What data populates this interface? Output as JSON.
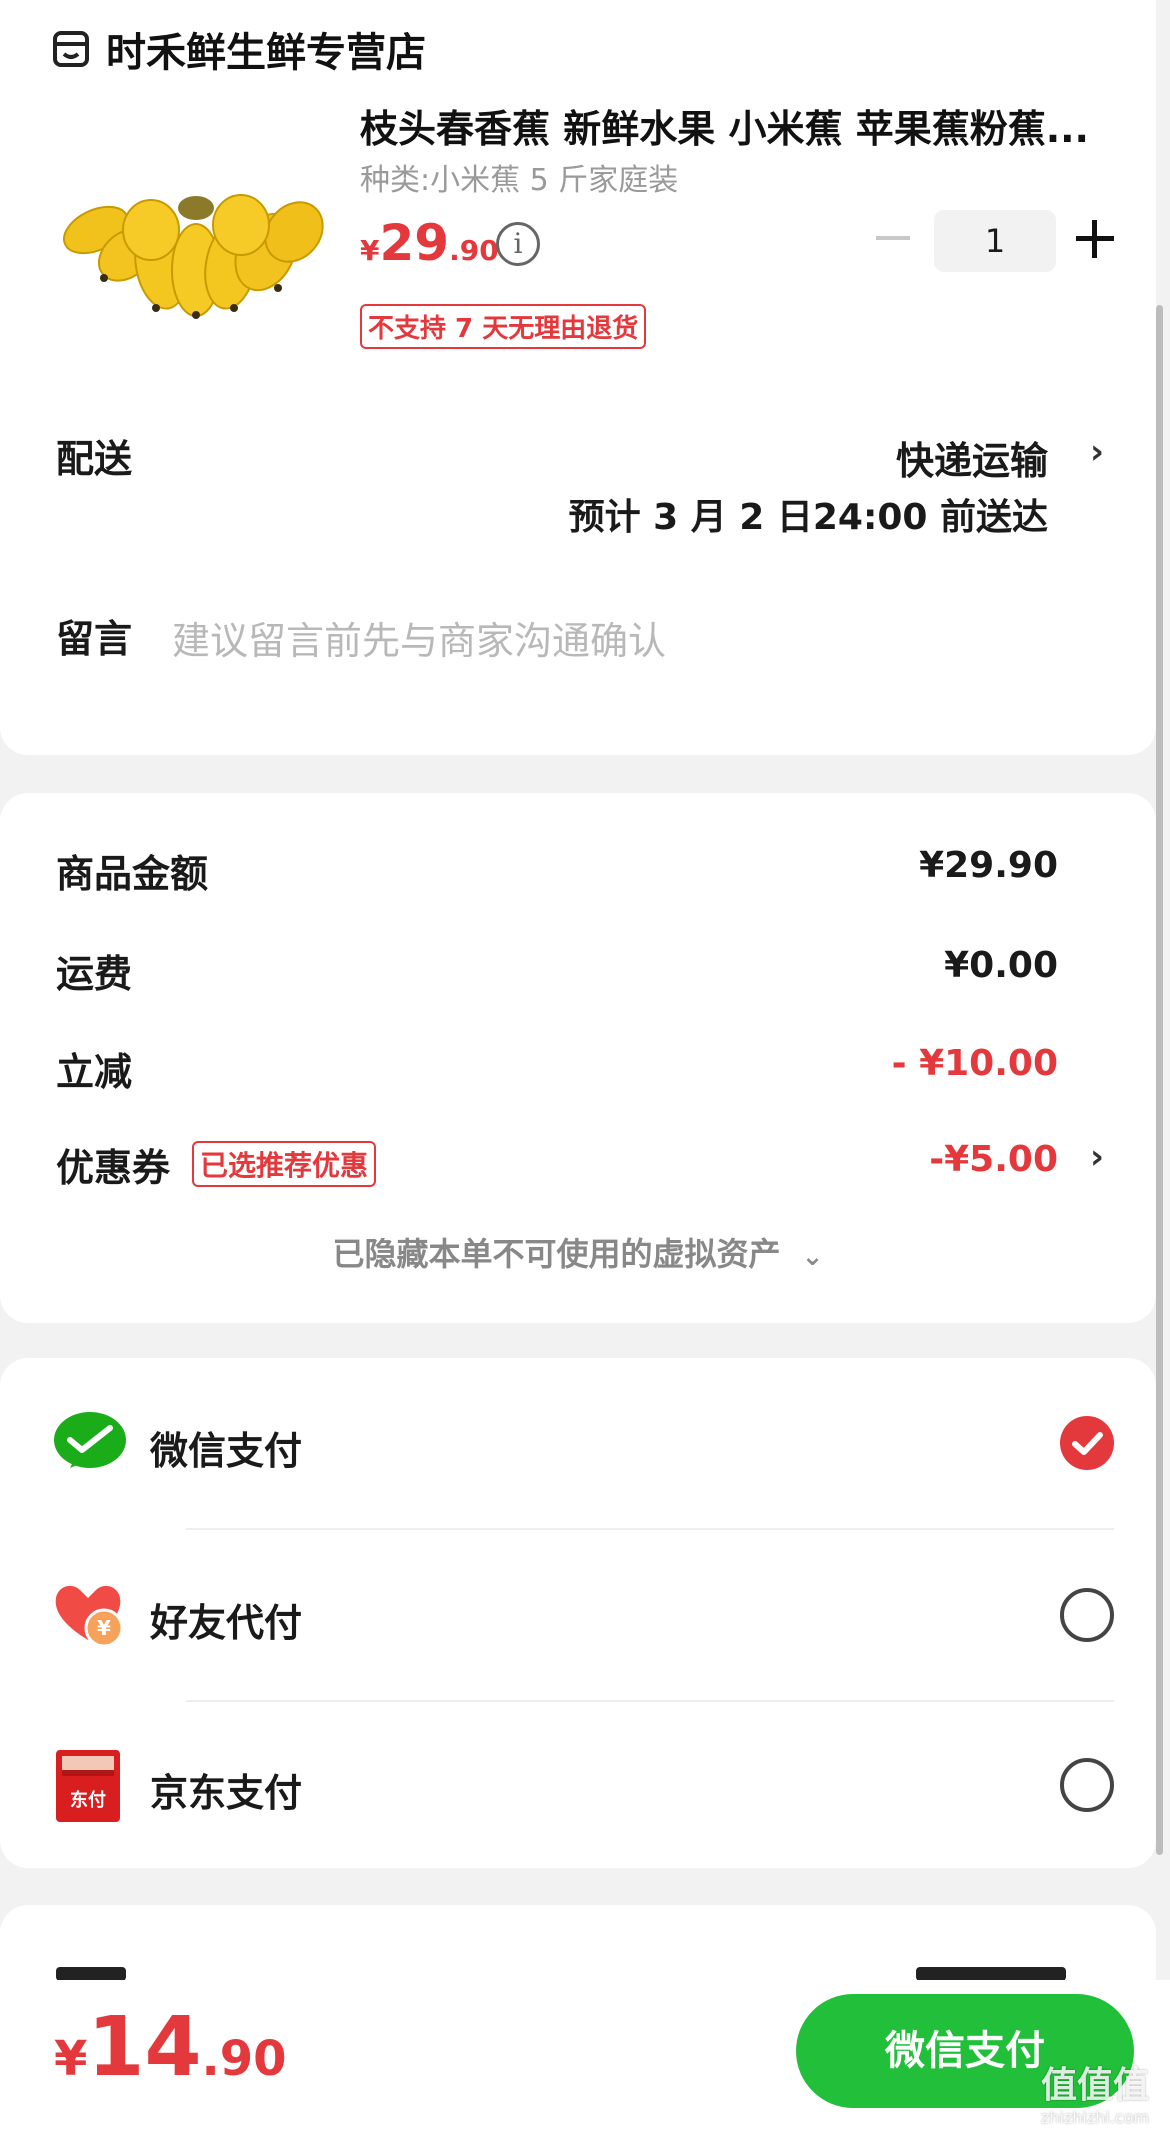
{
  "store": {
    "name": "时禾鲜生鲜专营店",
    "icon": "store-icon"
  },
  "product": {
    "title": "枝头春香蕉 新鲜水果 小米蕉 苹果蕉粉蕉...",
    "variant": "种类:小米蕉 5 斤家庭装",
    "price_symbol": "¥",
    "price_int": "29",
    "price_dec": ".90",
    "quantity": "1",
    "tag": "不支持 7 天无理由退货"
  },
  "delivery": {
    "label": "配送",
    "method": "快递运输",
    "eta": "预计 3 月 2 日24:00 前送达"
  },
  "message": {
    "label": "留言",
    "placeholder": "建议留言前先与商家沟通确认"
  },
  "summary": {
    "goods_label": "商品金额",
    "goods_value": "¥29.90",
    "shipping_label": "运费",
    "shipping_value": "¥0.00",
    "discount_label": "立减",
    "discount_value": "- ¥10.00",
    "coupon_label": "优惠券",
    "coupon_tag": "已选推荐优惠",
    "coupon_value": "-¥5.00",
    "hidden_assets": "已隐藏本单不可使用的虚拟资产"
  },
  "payment": {
    "options": [
      {
        "label": "微信支付",
        "icon": "wechat-pay-icon",
        "selected": true
      },
      {
        "label": "好友代付",
        "icon": "friend-pay-icon",
        "selected": false
      },
      {
        "label": "京东支付",
        "icon": "jd-pay-icon",
        "selected": false
      }
    ],
    "jd_icon_text": "东付"
  },
  "footer": {
    "total_symbol": "¥",
    "total_int": "14",
    "total_dec": ".90",
    "pay_button": "微信支付",
    "watermark": "值值值",
    "watermark_url": "zhizhizhi.com"
  },
  "colors": {
    "accent": "#e4393c",
    "wechat_green": "#1aad19",
    "pay_button": "#22c03a"
  }
}
